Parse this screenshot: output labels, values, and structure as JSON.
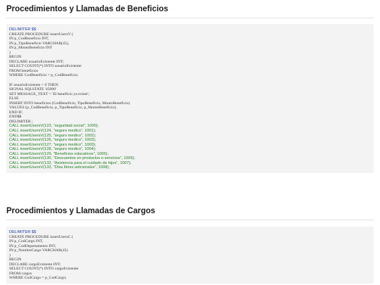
{
  "sections": [
    {
      "title": "Procedimientos y Llamadas de Beneficios",
      "delimiter_open": "DELIMITER $$",
      "sql_lines_1": [
        "CREATE PROCEDURE insertUsersV (",
        "IN p_CodBeneficio INT,",
        "IN p_TipoBeneficio VARCHAR(45),",
        "IN p_MontoBeneficio INT",
        ")",
        "BEGIN",
        "DECLARE usuarioExistente INT;",
        "SELECT COUNT(*) INTO usuarioExistente",
        "FROM beneficios",
        "WHERE CodBeneficio = p_CodBeneficio;"
      ],
      "sql_lines_2": [
        "IF usuarioExistente > 0 THEN",
        "SIGNAL SQLSTATE '45000'",
        "SET MESSAGE_TEXT = 'El beneficio ya existe';",
        "ELSE",
        "INSERT INTO beneficios (CodBeneficio, TipoBeneficio, MontoBeneficio)",
        "VALUES (p_CodBeneficio, p_TipoBeneficio, p_MontoBeneficio);",
        "END IF;",
        "END$$"
      ],
      "delimiter_close": "DELIMITER ;",
      "calls": [
        "CALL insertUsersV(123, \"seguridad social\", 1000);",
        "CALL insertUsersV(124, \"seguro medico\", 1001);",
        "CALL insertUsersV(125, \"seguro medico\", 1002);",
        "CALL insertUsersV(126, \"seguro medico\", 1003);",
        "CALL insertUsersV(127, \"seguro medico\", 1003);",
        "CALL insertUsersV(128, \"seguro medico\", 1004);",
        "CALL insertUsersV(129, \"Beneficios educativos\", 1005);",
        "CALL insertUsersV(130, \"Descuentos en productos o servicios\", 1006);",
        "CALL insertUsersV(132, \"Asistencia para el cuidado de hijos\", 1007);",
        "CALL insertUsersV(133, \"Días libres adicionales\", 1008);"
      ]
    },
    {
      "title": "Procedimientos y Llamadas de Cargos",
      "delimiter_open": "DELIMITER $$",
      "sql_lines_1": [
        "CREATE PROCEDURE insertUsersC (",
        "IN p_CodCargo INT,",
        "IN p_CodDepartamento INT,",
        "IN p_NombreCargo VARCHAR(45)",
        ")",
        "BEGIN",
        "DECLARE cargoExistente INT;",
        "SELECT COUNT(*) INTO cargoExistente",
        "FROM cargos",
        "WHERE CodCargo = p_CodCargo;"
      ]
    }
  ]
}
